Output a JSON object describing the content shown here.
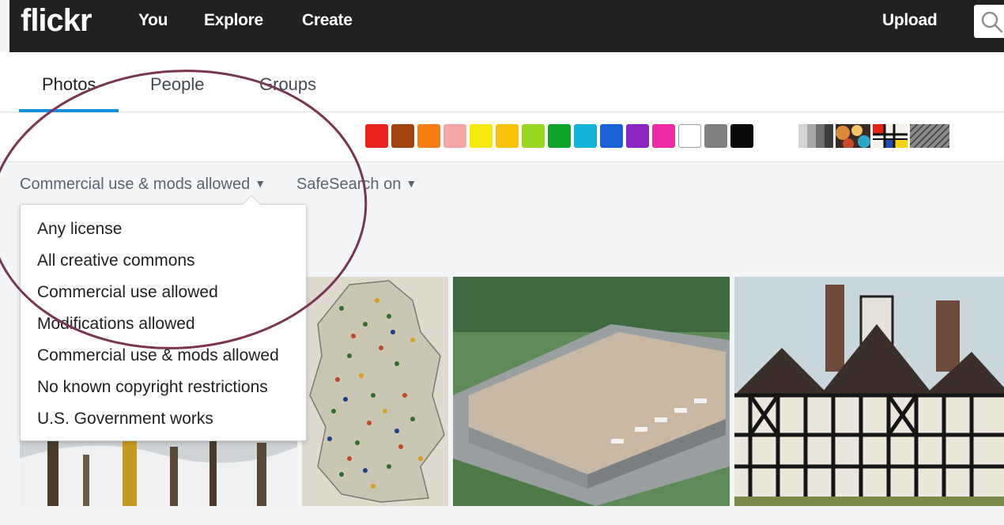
{
  "header": {
    "logo": "flickr",
    "nav": {
      "you": "You",
      "explore": "Explore",
      "create": "Create"
    },
    "upload": "Upload",
    "search_icon": "search-icon"
  },
  "tabs": [
    {
      "label": "Photos",
      "selected": true
    },
    {
      "label": "People",
      "selected": false
    },
    {
      "label": "Groups",
      "selected": false
    }
  ],
  "color_filters": {
    "swatches": [
      "#e8231e",
      "#a0430f",
      "#f57e15",
      "#f4a6a9",
      "#f6ea0d",
      "#f8c30c",
      "#99d620",
      "#0fa32b",
      "#11b3d6",
      "#1a61d6",
      "#8c26c1",
      "#ed2ba2",
      "#ffffff",
      "#7f7f7f",
      "#0a0a0a"
    ],
    "patterns": [
      "black-and-white-pattern",
      "shallow-depth-of-field-pattern",
      "minimalist-pattern",
      "patterns-pattern"
    ]
  },
  "filters": {
    "license": "Commercial use & mods allowed",
    "safesearch": "SafeSearch on"
  },
  "license_menu": {
    "options": [
      "Any license",
      "All creative commons",
      "Commercial use allowed",
      "Modifications allowed",
      "Commercial use & mods allowed",
      "No known copyright restrictions",
      "U.S. Government works"
    ]
  },
  "accent_color": "#128fdc",
  "annotation_color": "#7a3552"
}
